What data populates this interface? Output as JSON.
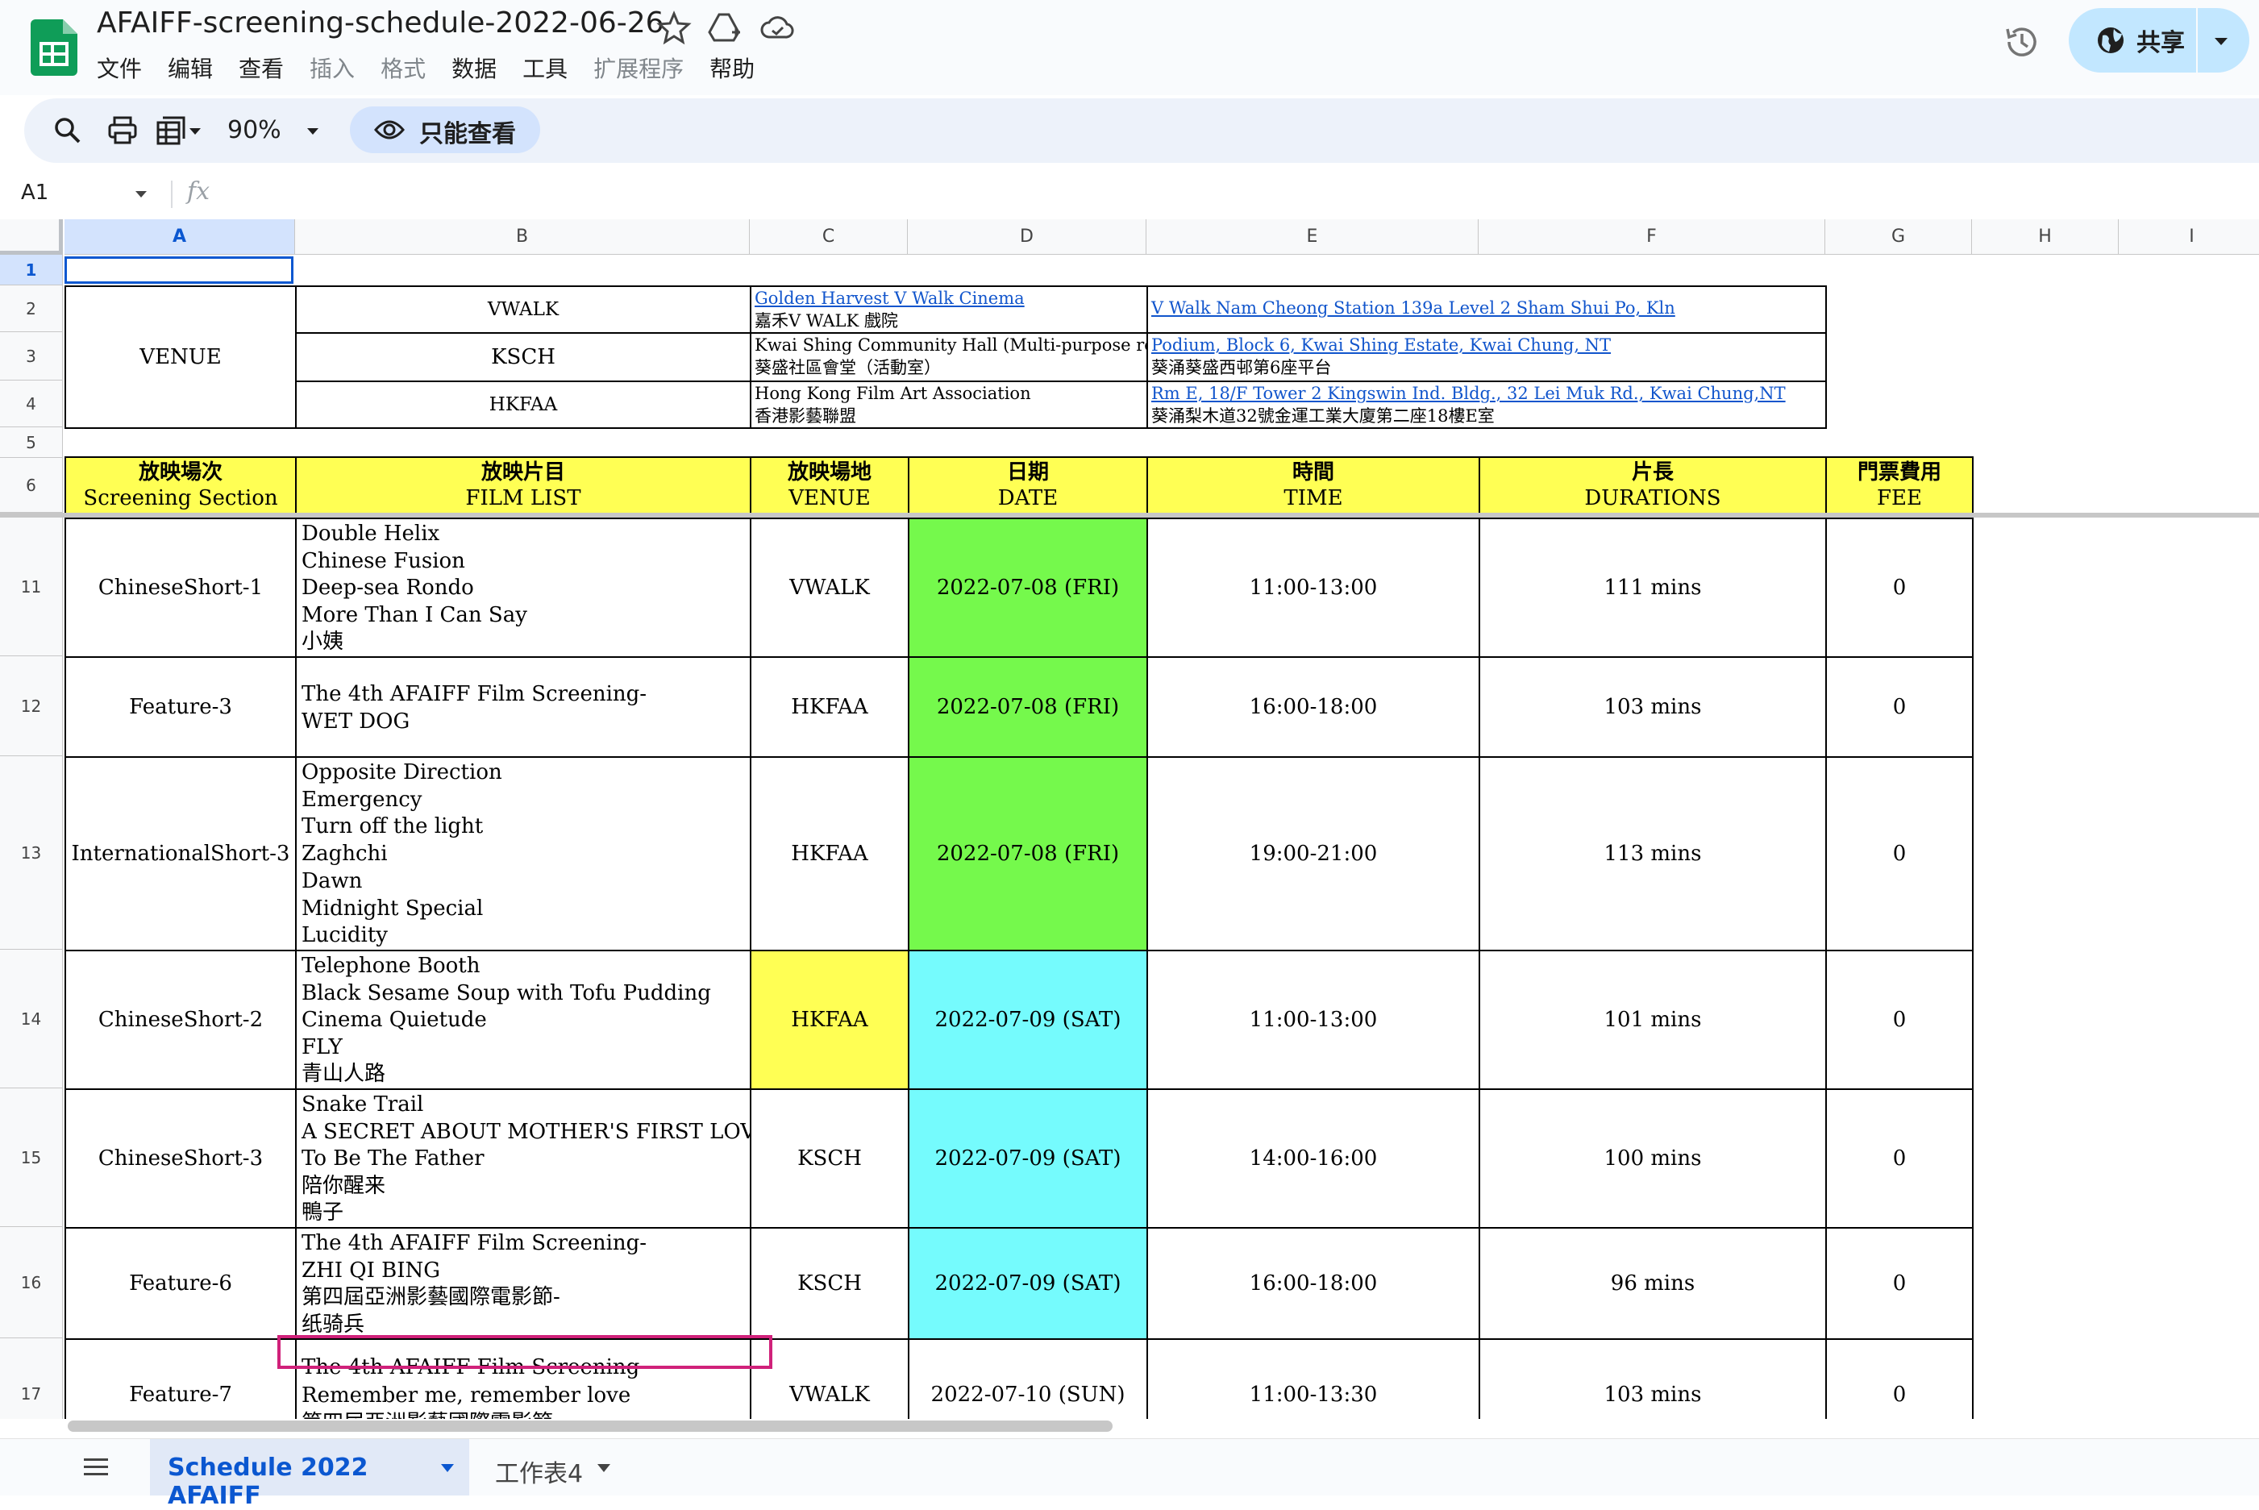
{
  "app": {
    "title": "AFAIFF-screening-schedule-2022-06-26",
    "share_label": "共享",
    "view_only_label": "只能查看",
    "zoom": "90%",
    "name_box": "A1",
    "fx": "fx",
    "colors": {
      "brand_green": "#0f9d58",
      "accent": "#0b57d0",
      "share_bg": "#c2e7ff"
    }
  },
  "menu": [
    {
      "label": "文件",
      "enabled": true
    },
    {
      "label": "编辑",
      "enabled": true
    },
    {
      "label": "查看",
      "enabled": true
    },
    {
      "label": "插入",
      "enabled": false
    },
    {
      "label": "格式",
      "enabled": false
    },
    {
      "label": "数据",
      "enabled": true
    },
    {
      "label": "工具",
      "enabled": true
    },
    {
      "label": "扩展程序",
      "enabled": false
    },
    {
      "label": "帮助",
      "enabled": true
    }
  ],
  "columns": [
    "A",
    "B",
    "C",
    "D",
    "E",
    "F",
    "G",
    "H",
    "I"
  ],
  "rows": [
    "1",
    "2",
    "3",
    "4",
    "5",
    "6",
    "11",
    "12",
    "13",
    "14",
    "15",
    "16",
    "17"
  ],
  "venue_label": "VENUE",
  "venues": [
    {
      "code": "VWALK",
      "name_link": "Golden Harvest V Walk Cinema",
      "name_zh": "嘉禾V WALK 戲院",
      "address_link": "V Walk Nam Cheong Station 139a Level 2 Sham Shui Po, Kln",
      "address_zh": ""
    },
    {
      "code": "KSCH",
      "name_link": "",
      "name_text": "Kwai Shing Community Hall (Multi-purpose room)",
      "name_zh": "葵盛社區會堂（活動室）",
      "address_link": "Podium, Block 6, Kwai Shing Estate, Kwai Chung, NT",
      "address_zh": "葵涌葵盛西邨第6座平台"
    },
    {
      "code": "HKFAA",
      "name_link": "",
      "name_text": "Hong Kong Film Art Association",
      "name_zh": "香港影藝聯盟",
      "address_link": "Rm E, 18/F Tower 2 Kingswin Ind. Bldg., 32 Lei Muk Rd., Kwai Chung,NT",
      "address_zh": "葵涌梨木道32號金運工業大廈第二座18樓E室"
    }
  ],
  "headers": [
    {
      "zh": "放映場次",
      "en": "Screening Section"
    },
    {
      "zh": "放映片目",
      "en": "FILM LIST"
    },
    {
      "zh": "放映場地",
      "en": "VENUE"
    },
    {
      "zh": "日期",
      "en": "DATE"
    },
    {
      "zh": "時間",
      "en": "TIME"
    },
    {
      "zh": "片長",
      "en": "DURATIONS"
    },
    {
      "zh": "門票費用",
      "en": "FEE"
    }
  ],
  "schedule": [
    {
      "section": "ChineseShort-1",
      "films": [
        "Double Helix",
        "Chinese Fusion",
        "Deep-sea Rondo",
        "More Than I Can Say",
        "小姨"
      ],
      "venue": "VWALK",
      "date": "2022-07-08 (FRI)",
      "time": "11:00-13:00",
      "duration": "111 mins",
      "fee": "0"
    },
    {
      "section": "Feature-3",
      "films": [
        "The 4th AFAIFF Film Screening-",
        "WET DOG"
      ],
      "venue": "HKFAA",
      "date": "2022-07-08 (FRI)",
      "time": "16:00-18:00",
      "duration": "103 mins",
      "fee": "0"
    },
    {
      "section": "InternationalShort-3",
      "films": [
        "Opposite Direction",
        "Emergency",
        "Turn off the light",
        "Zaghchi",
        "Dawn",
        "Midnight Special",
        "Lucidity"
      ],
      "venue": "HKFAA",
      "date": "2022-07-08 (FRI)",
      "time": "19:00-21:00",
      "duration": "113 mins",
      "fee": "0"
    },
    {
      "section": "ChineseShort-2",
      "films": [
        "Telephone Booth",
        "Black Sesame Soup with Tofu Pudding",
        "Cinema Quietude",
        "FLY",
        "青山人路"
      ],
      "venue": "HKFAA",
      "date": "2022-07-09 (SAT)",
      "time": "11:00-13:00",
      "duration": "101 mins",
      "fee": "0"
    },
    {
      "section": "ChineseShort-3",
      "films": [
        "Snake Trail",
        "A SECRET ABOUT MOTHER'S FIRST LOVE",
        "To Be The Father",
        "陪你醒来",
        "鴨子"
      ],
      "venue": "KSCH",
      "date": "2022-07-09 (SAT)",
      "time": "14:00-16:00",
      "duration": "100 mins",
      "fee": "0"
    },
    {
      "section": "Feature-6",
      "films": [
        "The 4th AFAIFF Film Screening-",
        "ZHI QI BING",
        "第四屆亞洲影藝國際電影節-",
        "纸骑兵"
      ],
      "venue": "KSCH",
      "date": "2022-07-09 (SAT)",
      "time": "16:00-18:00",
      "duration": "96 mins",
      "fee": "0"
    },
    {
      "section": "Feature-7",
      "films": [
        "The 4th AFAIFF Film Screening-",
        "Remember me, remember love",
        "第四屆亞洲影藝國際電影節-"
      ],
      "venue": "VWALK",
      "date": "2022-07-10 (SUN)",
      "time": "11:00-13:30",
      "duration": "103 mins",
      "fee": "0"
    }
  ],
  "tabs": [
    {
      "label": "Schedule 2022 AFAIFF",
      "active": true
    },
    {
      "label": "工作表4",
      "active": false
    }
  ]
}
